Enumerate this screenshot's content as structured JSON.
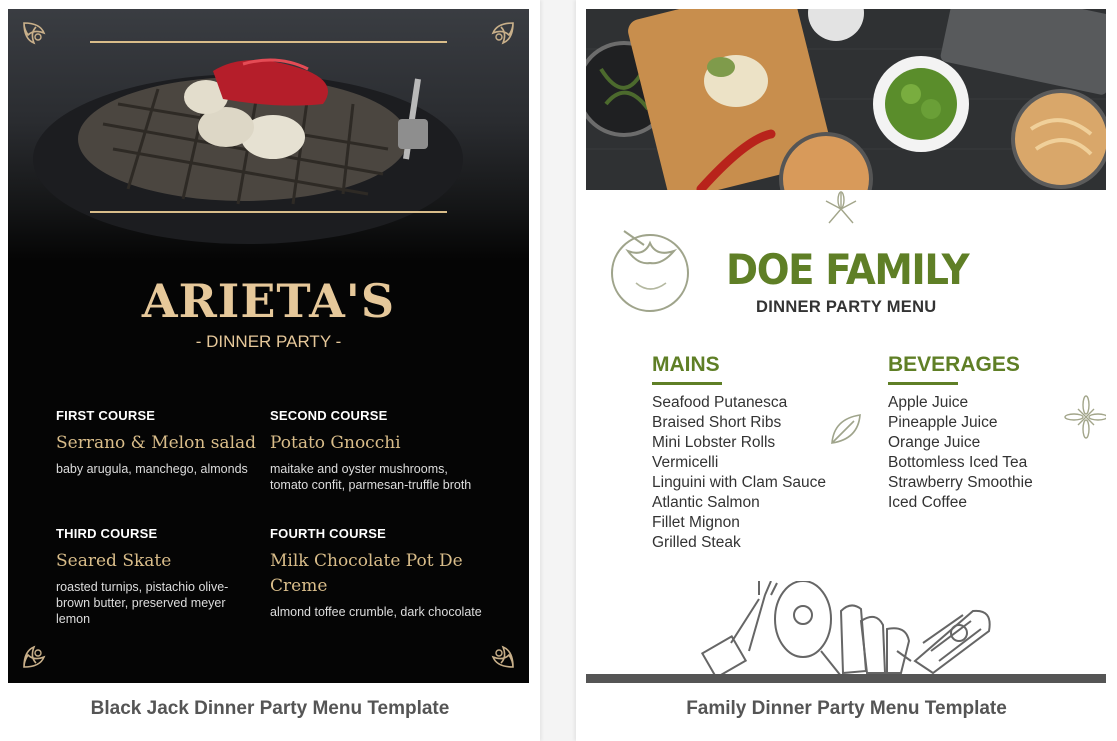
{
  "cards": [
    {
      "caption": "Black Jack Dinner Party Menu Template",
      "menu": {
        "title": "ARIETA'S",
        "subtitle": "- DINNER PARTY -",
        "courses": [
          {
            "label": "FIRST COURSE",
            "dish": "Serrano & Melon salad",
            "desc": "baby arugula, manchego, almonds"
          },
          {
            "label": "SECOND COURSE",
            "dish": "Potato Gnocchi",
            "desc": "maitake and oyster mushrooms, tomato confit, parmesan-truffle broth"
          },
          {
            "label": "THIRD COURSE",
            "dish": "Seared Skate",
            "desc": "roasted turnips, pistachio olive-brown butter, preserved meyer lemon"
          },
          {
            "label": "FOURTH COURSE",
            "dish": "Milk Chocolate Pot De Creme",
            "desc": "almond toffee crumble, dark chocolate"
          }
        ],
        "colors": {
          "background": "#050505",
          "accent": "#d9bd8a"
        }
      }
    },
    {
      "caption": "Family Dinner Party Menu Template",
      "menu": {
        "title": "DOE FAMILY",
        "subtitle": "DINNER PARTY MENU",
        "sections": [
          {
            "heading": "MAINS",
            "items": [
              "Seafood Putanesca",
              "Braised Short Ribs",
              "Mini Lobster Rolls",
              "Vermicelli",
              "Linguini with Clam Sauce",
              "Atlantic Salmon",
              "Fillet Mignon",
              "Grilled Steak"
            ]
          },
          {
            "heading": "BEVERAGES",
            "items": [
              "Apple Juice",
              "Pineapple Juice",
              "Orange Juice",
              "Bottomless Iced Tea",
              "Strawberry Smoothie",
              "Iced Coffee"
            ]
          }
        ],
        "colors": {
          "accent": "#5f7f26",
          "text": "#333333"
        }
      }
    }
  ]
}
